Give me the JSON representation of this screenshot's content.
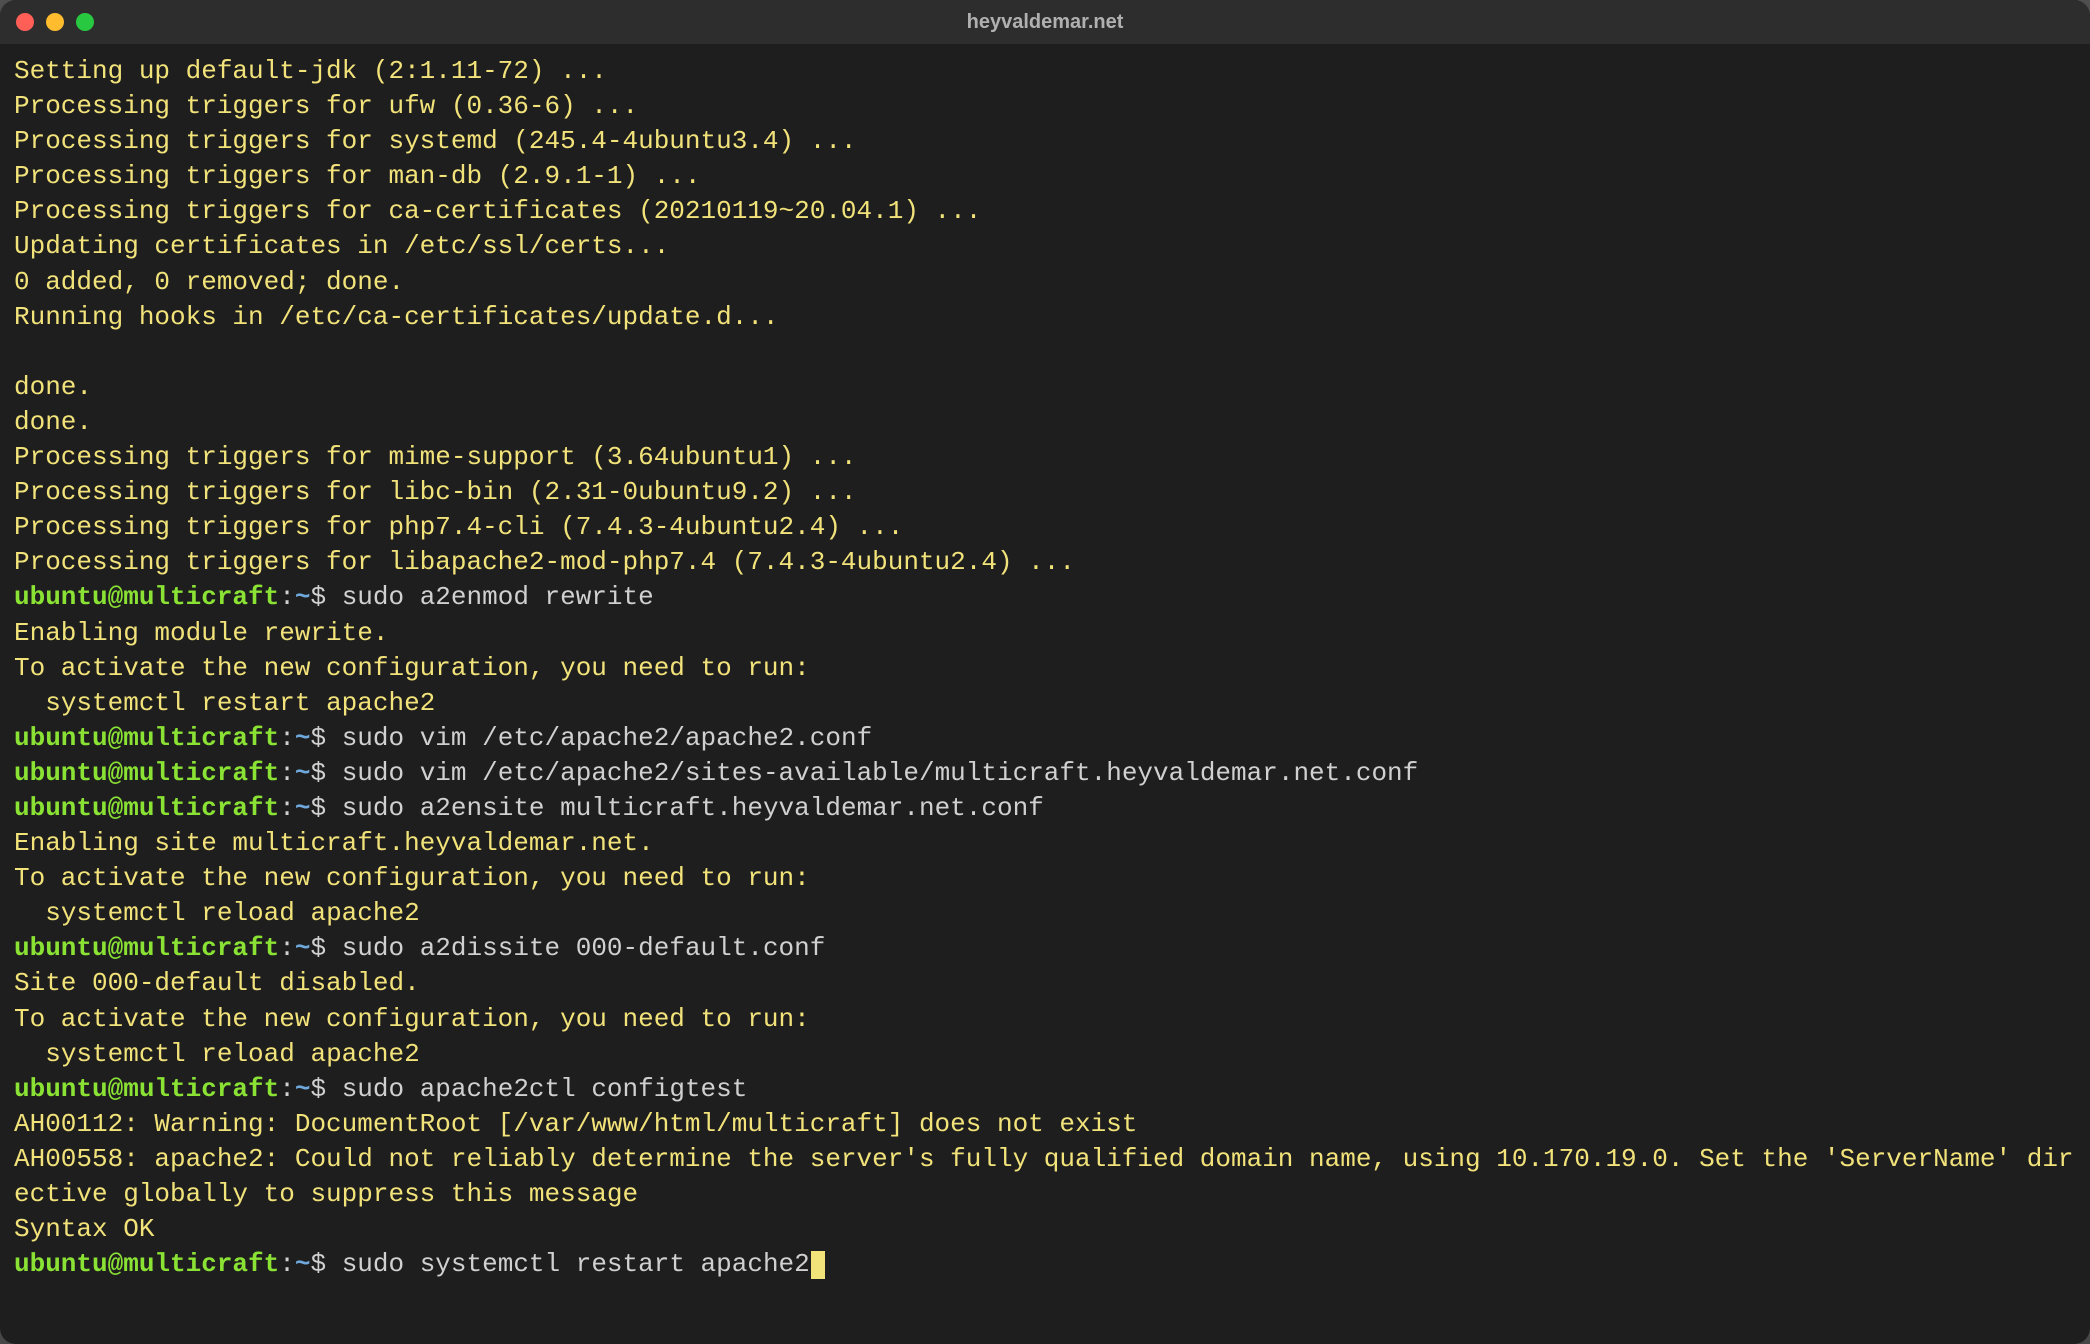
{
  "window": {
    "title": "heyvaldemar.net"
  },
  "colors": {
    "bg": "#1e1e1e",
    "titlebar": "#2d2d2d",
    "text": "#f2e27a",
    "prompt_user": "#8ae234",
    "prompt_path": "#6fa8dc",
    "cmd": "#d0d0d0"
  },
  "prompt": {
    "user_host": "ubuntu@multicraft",
    "sep1": ":",
    "path": "~",
    "dollar": "$"
  },
  "lines": [
    {
      "type": "out",
      "text": "Setting up default-jdk (2:1.11-72) ..."
    },
    {
      "type": "out",
      "text": "Processing triggers for ufw (0.36-6) ..."
    },
    {
      "type": "out",
      "text": "Processing triggers for systemd (245.4-4ubuntu3.4) ..."
    },
    {
      "type": "out",
      "text": "Processing triggers for man-db (2.9.1-1) ..."
    },
    {
      "type": "out",
      "text": "Processing triggers for ca-certificates (20210119~20.04.1) ..."
    },
    {
      "type": "out",
      "text": "Updating certificates in /etc/ssl/certs..."
    },
    {
      "type": "out",
      "text": "0 added, 0 removed; done."
    },
    {
      "type": "out",
      "text": "Running hooks in /etc/ca-certificates/update.d..."
    },
    {
      "type": "out",
      "text": ""
    },
    {
      "type": "out",
      "text": "done."
    },
    {
      "type": "out",
      "text": "done."
    },
    {
      "type": "out",
      "text": "Processing triggers for mime-support (3.64ubuntu1) ..."
    },
    {
      "type": "out",
      "text": "Processing triggers for libc-bin (2.31-0ubuntu9.2) ..."
    },
    {
      "type": "out",
      "text": "Processing triggers for php7.4-cli (7.4.3-4ubuntu2.4) ..."
    },
    {
      "type": "out",
      "text": "Processing triggers for libapache2-mod-php7.4 (7.4.3-4ubuntu2.4) ..."
    },
    {
      "type": "cmd",
      "text": "sudo a2enmod rewrite"
    },
    {
      "type": "out",
      "text": "Enabling module rewrite."
    },
    {
      "type": "out",
      "text": "To activate the new configuration, you need to run:"
    },
    {
      "type": "out",
      "text": "  systemctl restart apache2"
    },
    {
      "type": "cmd",
      "text": "sudo vim /etc/apache2/apache2.conf"
    },
    {
      "type": "cmd",
      "text": "sudo vim /etc/apache2/sites-available/multicraft.heyvaldemar.net.conf"
    },
    {
      "type": "cmd",
      "text": "sudo a2ensite multicraft.heyvaldemar.net.conf"
    },
    {
      "type": "out",
      "text": "Enabling site multicraft.heyvaldemar.net."
    },
    {
      "type": "out",
      "text": "To activate the new configuration, you need to run:"
    },
    {
      "type": "out",
      "text": "  systemctl reload apache2"
    },
    {
      "type": "cmd",
      "text": "sudo a2dissite 000-default.conf"
    },
    {
      "type": "out",
      "text": "Site 000-default disabled."
    },
    {
      "type": "out",
      "text": "To activate the new configuration, you need to run:"
    },
    {
      "type": "out",
      "text": "  systemctl reload apache2"
    },
    {
      "type": "cmd",
      "text": "sudo apache2ctl configtest"
    },
    {
      "type": "out",
      "text": "AH00112: Warning: DocumentRoot [/var/www/html/multicraft] does not exist"
    },
    {
      "type": "out",
      "text": "AH00558: apache2: Could not reliably determine the server's fully qualified domain name, using 10.170.19.0. Set the 'ServerName' directive globally to suppress this message"
    },
    {
      "type": "out",
      "text": "Syntax OK"
    },
    {
      "type": "cmd",
      "text": "sudo systemctl restart apache2",
      "cursor": true
    }
  ]
}
